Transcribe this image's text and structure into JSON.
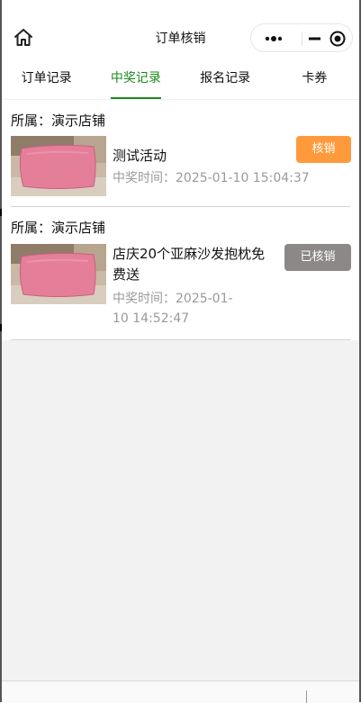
{
  "header": {
    "title": "订单核销",
    "home_icon": "home-icon",
    "capsule": {
      "more_icon": "more-dots-icon",
      "minimize_icon": "minimize-icon",
      "close_icon": "target-close-icon"
    }
  },
  "tabs": [
    {
      "label": "订单记录",
      "active": false
    },
    {
      "label": "中奖记录",
      "active": true
    },
    {
      "label": "报名记录",
      "active": false
    },
    {
      "label": "卡券",
      "active": false
    }
  ],
  "records": [
    {
      "shop": "所属：演示店铺",
      "name": "测试活动",
      "time": "中奖时间：2025-01-10 15:04:37",
      "button": "核销",
      "button_state": "pending",
      "image": "pink-pillow-image"
    },
    {
      "shop": "所属：演示店铺",
      "name": "店庆20个亚麻沙发抱枕免费送",
      "time": "中奖时间：2025-01-10 14:52:47",
      "button": "已核销",
      "button_state": "done",
      "image": "pink-pillow-image"
    }
  ],
  "colors": {
    "accent_green": "#1a8a1a",
    "pending_button": "#ff9a3c",
    "done_button": "#8c8888"
  }
}
